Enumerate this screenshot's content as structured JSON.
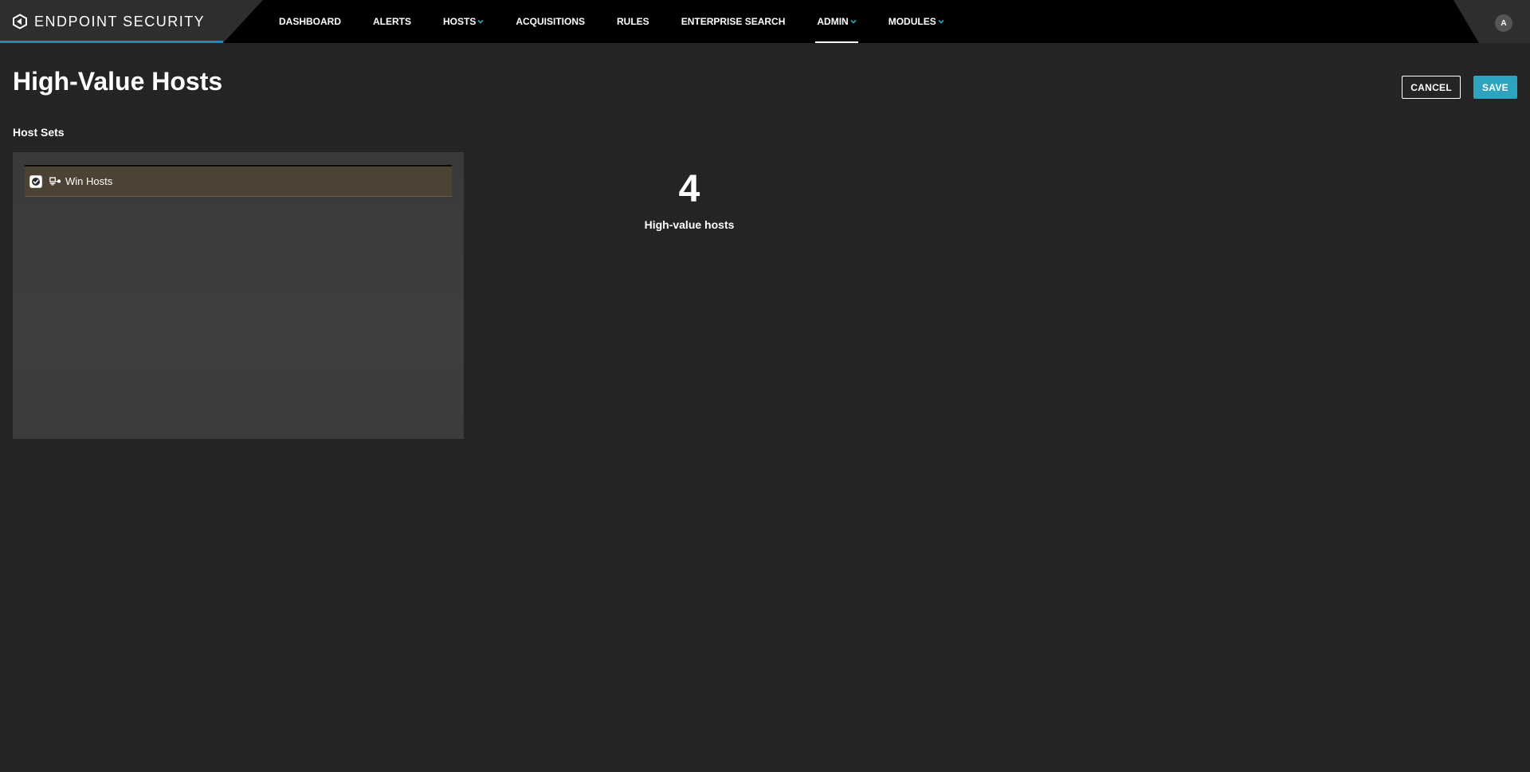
{
  "app": {
    "brand_title": "ENDPOINT SECURITY",
    "accent_color": "#1e88c7"
  },
  "nav": {
    "items": [
      {
        "label": "DASHBOARD",
        "has_dropdown": false,
        "active": false
      },
      {
        "label": "ALERTS",
        "has_dropdown": false,
        "active": false
      },
      {
        "label": "HOSTS",
        "has_dropdown": true,
        "active": false
      },
      {
        "label": "ACQUISITIONS",
        "has_dropdown": false,
        "active": false
      },
      {
        "label": "RULES",
        "has_dropdown": false,
        "active": false
      },
      {
        "label": "ENTERPRISE SEARCH",
        "has_dropdown": false,
        "active": false
      },
      {
        "label": "ADMIN",
        "has_dropdown": true,
        "active": true
      },
      {
        "label": "MODULES",
        "has_dropdown": true,
        "active": false
      }
    ],
    "chevron_color": "#2ea3bd"
  },
  "user": {
    "avatar_initial": "A"
  },
  "page": {
    "title": "High-Value Hosts"
  },
  "actions": {
    "cancel_label": "CANCEL",
    "save_label": "SAVE",
    "save_color": "#2ea3bd"
  },
  "host_sets": {
    "section_label": "Host Sets",
    "items": [
      {
        "label": "Win Hosts",
        "checked": true,
        "icon": "host-set-icon"
      }
    ],
    "selected_row_color": "#4c4335"
  },
  "stat": {
    "value": "4",
    "label": "High-value hosts"
  }
}
